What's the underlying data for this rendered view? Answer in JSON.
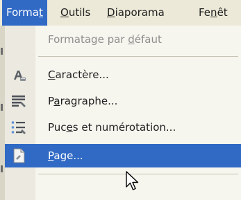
{
  "menubar": {
    "format": {
      "pre": "Forma",
      "accel": "t",
      "post": ""
    },
    "outils": {
      "pre": "",
      "accel": "O",
      "post": "utils"
    },
    "diaporama": {
      "pre": "",
      "accel": "D",
      "post": "iaporama"
    },
    "fenetre": {
      "pre": "Fe",
      "accel": "n",
      "post": "êt"
    }
  },
  "menu": {
    "items": [
      {
        "pre": "Formatage par ",
        "accel": "d",
        "post": "éfaut",
        "icon": "none",
        "enabled": false
      },
      {
        "pre": "",
        "accel": "C",
        "post": "aractère...",
        "icon": "character-icon",
        "enabled": true
      },
      {
        "pre": "P",
        "accel": "a",
        "post": "ragraphe...",
        "icon": "paragraph-icon",
        "enabled": true
      },
      {
        "pre": "Puc",
        "accel": "e",
        "post": "s et numérotation...",
        "icon": "bullets-icon",
        "enabled": true
      },
      {
        "pre": "",
        "accel": "P",
        "post": "age...",
        "icon": "page-icon",
        "enabled": true,
        "selected": true
      }
    ]
  },
  "colors": {
    "selection": "#316ac5",
    "menubar_bg": "#ece9d8",
    "menu_bg": "#f6f5ee",
    "disabled_text": "#8e8e8e"
  }
}
